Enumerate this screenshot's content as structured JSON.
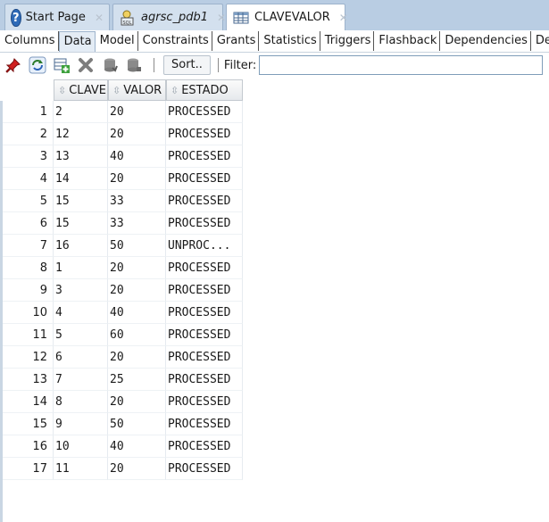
{
  "doc_tabs": [
    {
      "label": "Start Page",
      "icon": "help-icon",
      "active": false
    },
    {
      "label": "agrsc_pdb1",
      "icon": "sql-worksheet-icon",
      "active": false
    },
    {
      "label": "CLAVEVALOR",
      "icon": "table-icon",
      "active": true
    }
  ],
  "sub_tabs": [
    "Columns",
    "Data",
    "Model",
    "Constraints",
    "Grants",
    "Statistics",
    "Triggers",
    "Flashback",
    "Dependencies",
    "Details"
  ],
  "toolbar": {
    "sort_label": "Sort..",
    "filter_label": "Filter:",
    "filter_value": ""
  },
  "grid": {
    "columns": [
      "CLAVE",
      "VALOR",
      "ESTADO"
    ],
    "rows": [
      {
        "n": "1",
        "clave": "2",
        "valor": "20",
        "estado": "PROCESSED"
      },
      {
        "n": "2",
        "clave": "12",
        "valor": "20",
        "estado": "PROCESSED"
      },
      {
        "n": "3",
        "clave": "13",
        "valor": "40",
        "estado": "PROCESSED"
      },
      {
        "n": "4",
        "clave": "14",
        "valor": "20",
        "estado": "PROCESSED"
      },
      {
        "n": "5",
        "clave": "15",
        "valor": "33",
        "estado": "PROCESSED"
      },
      {
        "n": "6",
        "clave": "15",
        "valor": "33",
        "estado": "PROCESSED"
      },
      {
        "n": "7",
        "clave": "16",
        "valor": "50",
        "estado": "UNPROC..."
      },
      {
        "n": "8",
        "clave": "1",
        "valor": "20",
        "estado": "PROCESSED"
      },
      {
        "n": "9",
        "clave": "3",
        "valor": "20",
        "estado": "PROCESSED"
      },
      {
        "n": "10",
        "clave": "4",
        "valor": "40",
        "estado": "PROCESSED"
      },
      {
        "n": "11",
        "clave": "5",
        "valor": "60",
        "estado": "PROCESSED"
      },
      {
        "n": "12",
        "clave": "6",
        "valor": "20",
        "estado": "PROCESSED"
      },
      {
        "n": "13",
        "clave": "7",
        "valor": "25",
        "estado": "PROCESSED"
      },
      {
        "n": "14",
        "clave": "8",
        "valor": "20",
        "estado": "PROCESSED"
      },
      {
        "n": "15",
        "clave": "9",
        "valor": "50",
        "estado": "PROCESSED"
      },
      {
        "n": "16",
        "clave": "10",
        "valor": "40",
        "estado": "PROCESSED"
      },
      {
        "n": "17",
        "clave": "11",
        "valor": "20",
        "estado": "PROCESSED"
      }
    ]
  }
}
